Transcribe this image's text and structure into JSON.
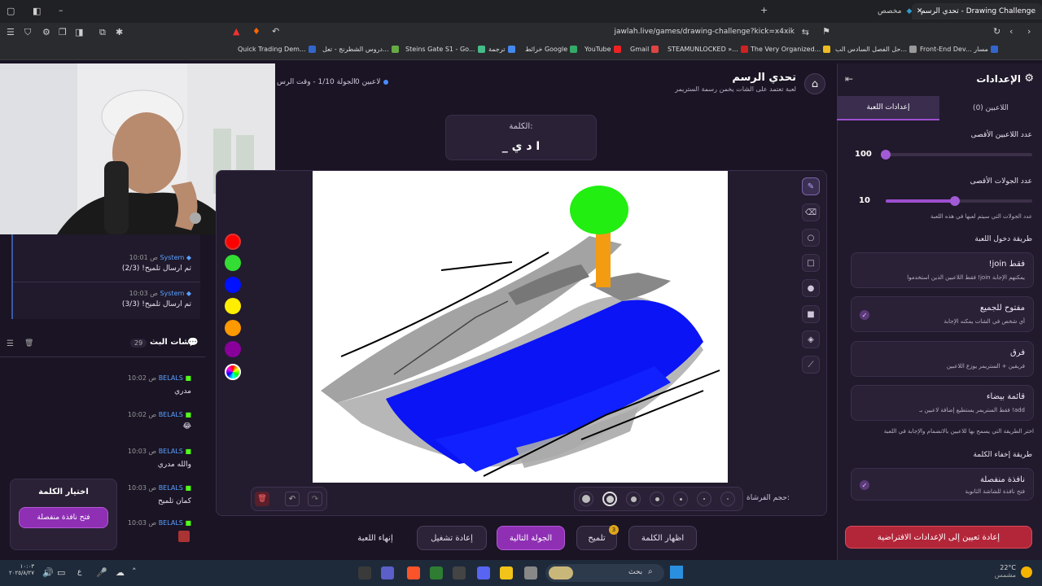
{
  "browser": {
    "tab_active": "تحدي الرسم - Drawing Challenge",
    "tab_other": "مخصص",
    "url": "jawlah.live/games/drawing-challenge?kick=x4xik",
    "bookmarks": [
      "Quick Trading Dem...",
      "دروس الشطرنج - تعل...",
      "Steins Gate S1 - Go...",
      "ترجمة",
      "خرائط Google",
      "YouTube",
      "Gmail",
      "STEAMUNLOCKED »...",
      "The Very Organized...",
      "حل الفصل السادس الب...",
      "Front-End Dev... مسار"
    ]
  },
  "header": {
    "title": "تحدي الرسم",
    "subtitle": "لعبة تعتمد على الشات يخمن رسمة الستريمر",
    "players_status": "0 لاعبين",
    "round_status": "الجولة 1/10 - وقت الرس"
  },
  "word_card": {
    "label": "الكلمة:",
    "value": "_ ا د ي"
  },
  "toolbar_bottom": {
    "brush_size_label": "حجم الفرشاة:"
  },
  "actions": {
    "end_game": "إنهاء اللعبة",
    "restart": "إعادة تشغيل",
    "next_round": "الجولة التالية",
    "hint": "تلميح",
    "hint_badge": "3",
    "show_word": "اظهار الكلمة"
  },
  "chat": {
    "system_messages": [
      {
        "name": "System",
        "time": "10:01 ص",
        "text": "تم ارسال تلميح! (2/3)"
      },
      {
        "name": "System",
        "time": "10:03 ص",
        "text": "تم ارسال تلميح! (3/3)"
      }
    ],
    "live_title": "شات البث",
    "live_count": "29",
    "messages": [
      {
        "name": "BELALS",
        "time": "10:02 ص",
        "text": "مدري"
      },
      {
        "name": "BELALS",
        "time": "10:02 ص",
        "text": "😂"
      },
      {
        "name": "BELALS",
        "time": "10:03 ص",
        "text": "والله مدري"
      },
      {
        "name": "BELALS",
        "time": "10:03 ص",
        "text": "كمان تلميح"
      },
      {
        "name": "BELALS",
        "time": "10:03 ص",
        "text": ""
      }
    ]
  },
  "choose_word": {
    "title": "اختيار الكلمة",
    "button": "فتح نافذة منفصلة"
  },
  "settings": {
    "title": "الإعدادات",
    "tab_players": "اللاعبين (0)",
    "tab_game": "إعدادات اللعبة",
    "max_players_label": "عدد اللاعبين الأقصى",
    "max_players_value": "100",
    "max_players_fraction": 0,
    "max_rounds_label": "عدد الجولات الأقصى",
    "max_rounds_value": "10",
    "max_rounds_fraction": 0.47,
    "max_rounds_hint": "عدد الجولات التي سيتم لعبها في هذه اللعبة",
    "join_method_label": "طريقة دخول اللعبة",
    "join_options": [
      {
        "title": "!join فقط",
        "desc": "فقط اللاعبين الذين استخدموا !join يمكنهم الإجابة",
        "checked": false
      },
      {
        "title": "مفتوح للجميع",
        "desc": "أي شخص في الشات يمكنه الإجابة",
        "checked": true
      },
      {
        "title": "فرق",
        "desc": "فريقين + الستريمر يوزع اللاعبين",
        "checked": false
      },
      {
        "title": "قائمة بيضاء",
        "desc": "فقط الستريمر يستطيع إضافة لاعبين بـ !add",
        "checked": false
      }
    ],
    "join_hint": "اختر الطريقة التي يسمح بها للاعبين بالانضمام والإجابة في اللعبة",
    "hide_word_label": "طريقة إخفاء الكلمة",
    "hide_option": {
      "title": "نافذة منفصلة",
      "desc": "فتح نافذة للشاشة الثانوية",
      "checked": true
    },
    "reset_button": "إعادة تعيين إلى الإعدادات الافتراضية"
  },
  "taskbar": {
    "weather": "22°C",
    "weather_desc": "مشمس",
    "search": "بحث",
    "clock": "١٠:٠٣",
    "date": "٢٠٢٥/٨/٢٧",
    "lang": "ع"
  },
  "colors": {
    "accent": "#9d4fd0",
    "palette": [
      "#ff0000",
      "#33dd33",
      "#0011ff",
      "#ffee00",
      "#ff9900",
      "#880099"
    ]
  }
}
